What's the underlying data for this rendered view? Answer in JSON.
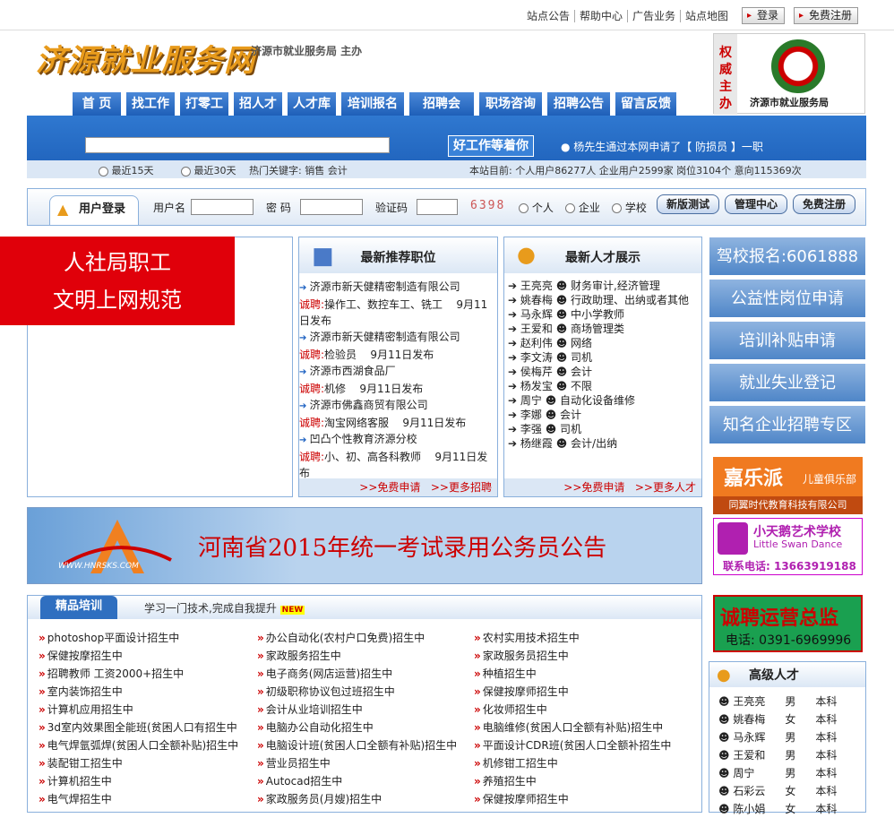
{
  "top": {
    "links": [
      "站点公告",
      "帮助中心",
      "广告业务",
      "站点地图"
    ],
    "login_btn": "登录",
    "register_btn": "免费注册"
  },
  "header": {
    "logo": "济源就业服务网",
    "subtitle": "济源市就业服务局 主办",
    "authority": "权威主办",
    "bureau": "济源市就业服务局"
  },
  "nav": [
    "首 页",
    "找工作",
    "打零工",
    "招人才",
    "人才库",
    "培训报名",
    "招聘会",
    "职场咨询",
    "招聘公告",
    "留言反馈"
  ],
  "search": {
    "good_job_btn": "好工作等着你",
    "news": "杨先生通过本网申请了【 防损员 】一职",
    "recent15": "最近15天",
    "recent30": "最近30天",
    "hot_keywords": "热门关键字: 销售 会计",
    "stats": "本站目前: 个人用户86277人 企业用户2599家 岗位3104个 意向115369次"
  },
  "login": {
    "tab": "用户登录",
    "username": "用户名",
    "password": "密 码",
    "captcha": "验证码",
    "captcha_code": "6398",
    "radio_personal": "个人",
    "radio_company": "企业",
    "radio_school": "学校",
    "btn_test": "新版测试",
    "btn_admin": "管理中心",
    "btn_register": "免费注册"
  },
  "red_block": [
    "人社局职工",
    "文明上网规范"
  ],
  "jobs": {
    "title": "最新推荐职位",
    "prefix": "诚聘:",
    "apply": ">>免费申请",
    "more": ">>更多招聘",
    "items": [
      {
        "company": "济源市新天健精密制造有限公司",
        "positions": "操作工、数控车工、铣工",
        "date": "9月11日发布"
      },
      {
        "company": "济源市新天健精密制造有限公司",
        "positions": "检验员",
        "date": "9月11日发布"
      },
      {
        "company": "济源市西湖食品厂",
        "positions": "机修",
        "date": "9月11日发布"
      },
      {
        "company": "济源市佛鑫商贸有限公司",
        "positions": "淘宝网络客服",
        "date": "9月11日发布"
      },
      {
        "company": "凹凸个性教育济源分校",
        "positions": "小、初、高各科教师",
        "date": "9月11日发布"
      }
    ]
  },
  "talents": {
    "title": "最新人才展示",
    "apply": ">>免费申请",
    "more": ">>更多人才",
    "items": [
      {
        "name": "王亮亮",
        "job": "财务审计,经济管理"
      },
      {
        "name": "姚春梅",
        "job": "行政助理、出纳或者其他"
      },
      {
        "name": "马永辉",
        "job": "中小学教师"
      },
      {
        "name": "王爱和",
        "job": "商场管理类"
      },
      {
        "name": "赵利伟",
        "job": "网络"
      },
      {
        "name": "李文涛",
        "job": "司机"
      },
      {
        "name": "侯梅芹",
        "job": "会计"
      },
      {
        "name": "杨发宝",
        "job": "不限"
      },
      {
        "name": "周宁",
        "job": "自动化设备维修"
      },
      {
        "name": "李娜",
        "job": "会计"
      },
      {
        "name": "李强",
        "job": "司机"
      },
      {
        "name": "杨继霞",
        "job": "会计/出纳"
      }
    ]
  },
  "right_buttons": [
    "驾校报名:6061888",
    "公益性岗位申请",
    "培训补贴申请",
    "就业失业登记",
    "知名企业招聘专区"
  ],
  "banner": {
    "text": "河南省2015年统一考试录用公务员公告",
    "logo_url": "WWW.HNRSKS.COM"
  },
  "training": {
    "tab": "精品培训",
    "subtitle": "学习一门技术,完成自我提升",
    "new_badge": "NEW",
    "col1": [
      "photoshop平面设计招生中",
      "保健按摩招生中",
      "招聘教师 工资2000+招生中",
      "室内装饰招生中",
      "计算机应用招生中",
      "3d室内效果图全能班(贫困人口有招生中",
      "电气焊氩弧焊(贫困人口全额补贴)招生中",
      "装配钳工招生中",
      "计算机招生中",
      "电气焊招生中"
    ],
    "col2": [
      "办公自动化(农村户口免费)招生中",
      "家政服务招生中",
      "电子商务(网店运营)招生中",
      "初级职称协议包过班招生中",
      "会计从业培训招生中",
      "电脑办公自动化招生中",
      "电脑设计班(贫困人口全额有补贴)招生中",
      "营业员招生中",
      "Autocad招生中",
      "家政服务员(月嫂)招生中"
    ],
    "col3": [
      "农村实用技术招生中",
      "家政服务员招生中",
      "种植招生中",
      "保健按摩师招生中",
      "化妆师招生中",
      "电脑维修(贫困人口全额有补贴)招生中",
      "平面设计CDR班(贫困人口全额补招生中",
      "机修钳工招生中",
      "养殖招生中",
      "保健按摩师招生中"
    ]
  },
  "ads": {
    "ad1_title": "嘉乐派",
    "ad1_sub": "儿童俱乐部",
    "ad1_company": "同翼时代教育科技有限公司",
    "ad2_title": "小天鹅艺术学校",
    "ad2_en": "Little Swan Dance",
    "ad2_phone": "联系电话: 13663919188",
    "ad3_title": "诚聘运营总监",
    "ad3_phone": "电话: 0391-6969996"
  },
  "senior": {
    "title": "高级人才",
    "items": [
      {
        "name": "王亮亮",
        "gender": "男",
        "edu": "本科"
      },
      {
        "name": "姚春梅",
        "gender": "女",
        "edu": "本科"
      },
      {
        "name": "马永辉",
        "gender": "男",
        "edu": "本科"
      },
      {
        "name": "王爱和",
        "gender": "男",
        "edu": "本科"
      },
      {
        "name": "周宁",
        "gender": "男",
        "edu": "本科"
      },
      {
        "name": "石彩云",
        "gender": "女",
        "edu": "本科"
      },
      {
        "name": "陈小娟",
        "gender": "女",
        "edu": "本科"
      }
    ]
  }
}
